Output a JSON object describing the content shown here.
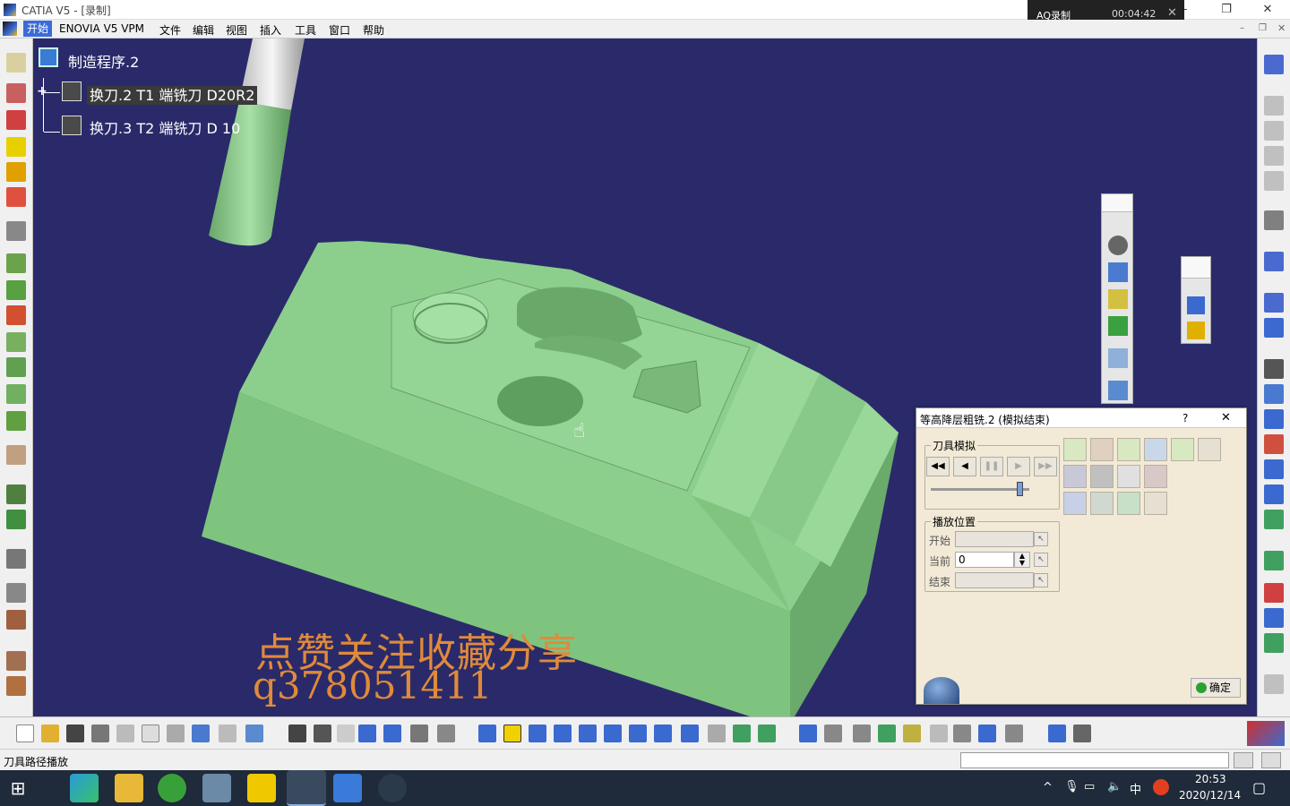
{
  "window": {
    "title": "CATIA V5 - [录制]",
    "minimize": "—",
    "restore": "❐",
    "close": "✕"
  },
  "recorder": {
    "title": "AQ录制",
    "time": "00:04:42",
    "close": "✕",
    "btn_window": "▭",
    "btn_record": "◉",
    "btn_pause": "||",
    "btn_mic": "🎙"
  },
  "menu": {
    "items": [
      "开始",
      "ENOVIA V5 VPM",
      "文件",
      "编辑",
      "视图",
      "插入",
      "工具",
      "窗口",
      "帮助"
    ]
  },
  "tree": {
    "root": "制造程序.2",
    "children": [
      "换刀.2  T1 端铣刀 D20R2",
      "换刀.3  T2 端铣刀 D 10"
    ]
  },
  "watermark": {
    "line1": "点赞关注收藏分享",
    "line2": "q378051411"
  },
  "dialog": {
    "title": "等高降层粗铣.2 (模拟结束)",
    "help": "?",
    "close": "✕",
    "group_tool_sim": "刀具模拟",
    "group_play_pos": "播放位置",
    "playback": [
      "◀◀",
      "◀",
      "❚❚",
      "▶",
      "▶▶"
    ],
    "slider_value": 0.9,
    "start_label": "开始",
    "current_label": "当前",
    "end_label": "结束",
    "start_value": "",
    "current_value": "0",
    "end_value": "",
    "ok_label": "确定"
  },
  "status": {
    "text": "刀具路径播放"
  },
  "taskbar": {
    "clock_time": "20:53",
    "clock_date": "2020/12/14",
    "ime": "中"
  },
  "colors": {
    "viewport_bg": "#2a2a6a",
    "part": "#8ccf8c",
    "watermark": "#e08a3a"
  }
}
